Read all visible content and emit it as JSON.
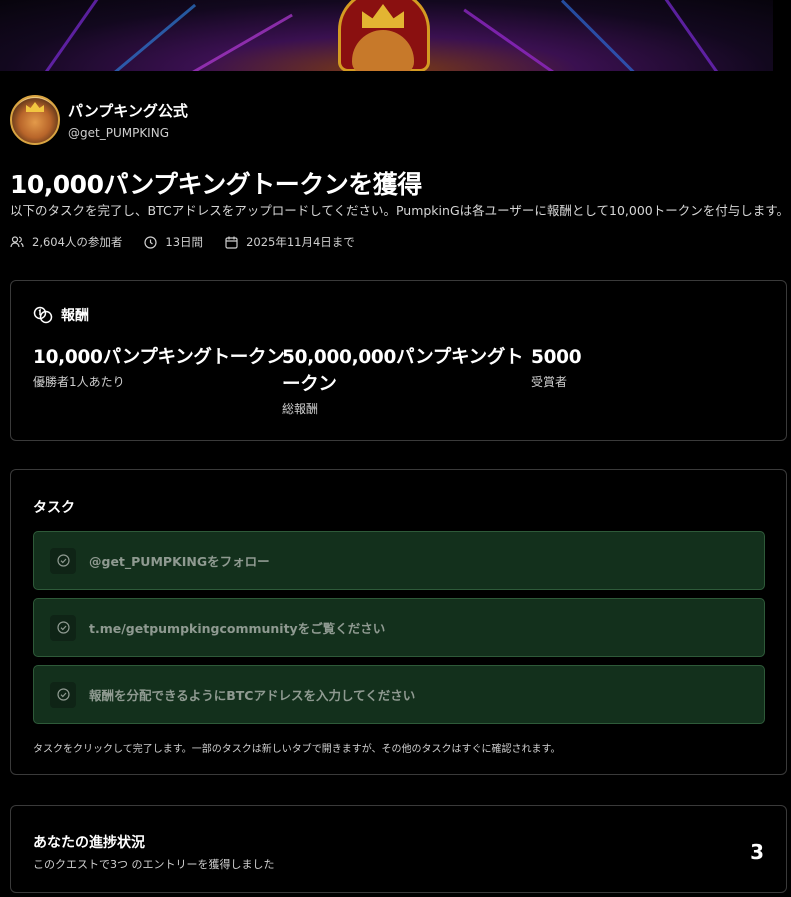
{
  "profile": {
    "name": "パンプキング公式",
    "handle": "@get_PUMPKING"
  },
  "quest": {
    "title": "10,000パンプキングトークンを獲得",
    "description": "以下のタスクを完了し、BTCアドレスをアップロードしてください。PumpkinGは各ユーザーに報酬として10,000トークンを付与します。",
    "meta": {
      "participants": "2,604人の参加者",
      "duration": "13日間",
      "deadline": "2025年11月4日まで"
    }
  },
  "rewards": {
    "heading": "報酬",
    "per_winner": {
      "value": "10,000パンプキングトークン",
      "label": "優勝者1人あたり"
    },
    "total": {
      "value_line1": "50,000,000パンプキングト",
      "value_line2": "ークン",
      "label": "総報酬"
    },
    "recipients": {
      "value": "5000",
      "label": "受賞者"
    }
  },
  "tasks": {
    "heading": "タスク",
    "items": [
      {
        "label": "@get_PUMPKINGをフォロー"
      },
      {
        "label": "t.me/getpumpkingcommunityをご覧ください"
      },
      {
        "label": "報酬を分配できるようにBTCアドレスを入力してください"
      }
    ],
    "note": "タスクをクリックして完了します。一部のタスクは新しいタブで開きますが、その他のタスクはすぐに確認されます。"
  },
  "progress": {
    "heading": "あなたの進捗状況",
    "subtitle": "このクエストで3つ のエントリーを獲得しました",
    "count": "3"
  },
  "colors": {
    "task_bg": "#13301c",
    "task_border": "#2e5a39",
    "border": "#3a3a3a"
  }
}
